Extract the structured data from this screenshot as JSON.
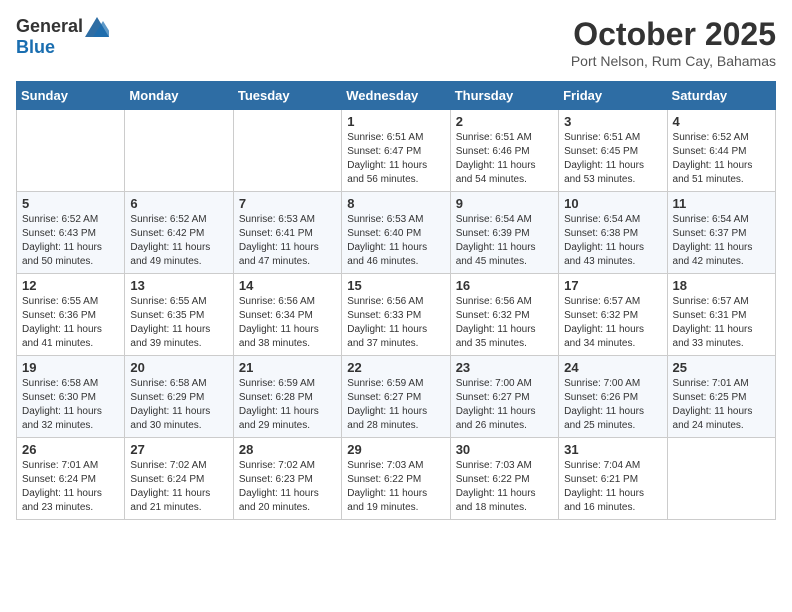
{
  "header": {
    "logo_general": "General",
    "logo_blue": "Blue",
    "month_title": "October 2025",
    "location": "Port Nelson, Rum Cay, Bahamas"
  },
  "weekdays": [
    "Sunday",
    "Monday",
    "Tuesday",
    "Wednesday",
    "Thursday",
    "Friday",
    "Saturday"
  ],
  "weeks": [
    [
      {
        "day": "",
        "info": ""
      },
      {
        "day": "",
        "info": ""
      },
      {
        "day": "",
        "info": ""
      },
      {
        "day": "1",
        "info": "Sunrise: 6:51 AM\nSunset: 6:47 PM\nDaylight: 11 hours and 56 minutes."
      },
      {
        "day": "2",
        "info": "Sunrise: 6:51 AM\nSunset: 6:46 PM\nDaylight: 11 hours and 54 minutes."
      },
      {
        "day": "3",
        "info": "Sunrise: 6:51 AM\nSunset: 6:45 PM\nDaylight: 11 hours and 53 minutes."
      },
      {
        "day": "4",
        "info": "Sunrise: 6:52 AM\nSunset: 6:44 PM\nDaylight: 11 hours and 51 minutes."
      }
    ],
    [
      {
        "day": "5",
        "info": "Sunrise: 6:52 AM\nSunset: 6:43 PM\nDaylight: 11 hours and 50 minutes."
      },
      {
        "day": "6",
        "info": "Sunrise: 6:52 AM\nSunset: 6:42 PM\nDaylight: 11 hours and 49 minutes."
      },
      {
        "day": "7",
        "info": "Sunrise: 6:53 AM\nSunset: 6:41 PM\nDaylight: 11 hours and 47 minutes."
      },
      {
        "day": "8",
        "info": "Sunrise: 6:53 AM\nSunset: 6:40 PM\nDaylight: 11 hours and 46 minutes."
      },
      {
        "day": "9",
        "info": "Sunrise: 6:54 AM\nSunset: 6:39 PM\nDaylight: 11 hours and 45 minutes."
      },
      {
        "day": "10",
        "info": "Sunrise: 6:54 AM\nSunset: 6:38 PM\nDaylight: 11 hours and 43 minutes."
      },
      {
        "day": "11",
        "info": "Sunrise: 6:54 AM\nSunset: 6:37 PM\nDaylight: 11 hours and 42 minutes."
      }
    ],
    [
      {
        "day": "12",
        "info": "Sunrise: 6:55 AM\nSunset: 6:36 PM\nDaylight: 11 hours and 41 minutes."
      },
      {
        "day": "13",
        "info": "Sunrise: 6:55 AM\nSunset: 6:35 PM\nDaylight: 11 hours and 39 minutes."
      },
      {
        "day": "14",
        "info": "Sunrise: 6:56 AM\nSunset: 6:34 PM\nDaylight: 11 hours and 38 minutes."
      },
      {
        "day": "15",
        "info": "Sunrise: 6:56 AM\nSunset: 6:33 PM\nDaylight: 11 hours and 37 minutes."
      },
      {
        "day": "16",
        "info": "Sunrise: 6:56 AM\nSunset: 6:32 PM\nDaylight: 11 hours and 35 minutes."
      },
      {
        "day": "17",
        "info": "Sunrise: 6:57 AM\nSunset: 6:32 PM\nDaylight: 11 hours and 34 minutes."
      },
      {
        "day": "18",
        "info": "Sunrise: 6:57 AM\nSunset: 6:31 PM\nDaylight: 11 hours and 33 minutes."
      }
    ],
    [
      {
        "day": "19",
        "info": "Sunrise: 6:58 AM\nSunset: 6:30 PM\nDaylight: 11 hours and 32 minutes."
      },
      {
        "day": "20",
        "info": "Sunrise: 6:58 AM\nSunset: 6:29 PM\nDaylight: 11 hours and 30 minutes."
      },
      {
        "day": "21",
        "info": "Sunrise: 6:59 AM\nSunset: 6:28 PM\nDaylight: 11 hours and 29 minutes."
      },
      {
        "day": "22",
        "info": "Sunrise: 6:59 AM\nSunset: 6:27 PM\nDaylight: 11 hours and 28 minutes."
      },
      {
        "day": "23",
        "info": "Sunrise: 7:00 AM\nSunset: 6:27 PM\nDaylight: 11 hours and 26 minutes."
      },
      {
        "day": "24",
        "info": "Sunrise: 7:00 AM\nSunset: 6:26 PM\nDaylight: 11 hours and 25 minutes."
      },
      {
        "day": "25",
        "info": "Sunrise: 7:01 AM\nSunset: 6:25 PM\nDaylight: 11 hours and 24 minutes."
      }
    ],
    [
      {
        "day": "26",
        "info": "Sunrise: 7:01 AM\nSunset: 6:24 PM\nDaylight: 11 hours and 23 minutes."
      },
      {
        "day": "27",
        "info": "Sunrise: 7:02 AM\nSunset: 6:24 PM\nDaylight: 11 hours and 21 minutes."
      },
      {
        "day": "28",
        "info": "Sunrise: 7:02 AM\nSunset: 6:23 PM\nDaylight: 11 hours and 20 minutes."
      },
      {
        "day": "29",
        "info": "Sunrise: 7:03 AM\nSunset: 6:22 PM\nDaylight: 11 hours and 19 minutes."
      },
      {
        "day": "30",
        "info": "Sunrise: 7:03 AM\nSunset: 6:22 PM\nDaylight: 11 hours and 18 minutes."
      },
      {
        "day": "31",
        "info": "Sunrise: 7:04 AM\nSunset: 6:21 PM\nDaylight: 11 hours and 16 minutes."
      },
      {
        "day": "",
        "info": ""
      }
    ]
  ]
}
